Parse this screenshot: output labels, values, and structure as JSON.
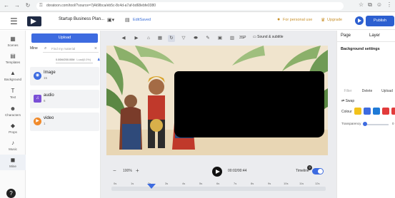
{
  "browser": {
    "url": "doratoon.com/tool/?source=7j4k9lbca/eb5c-8c4d-a7af-bd68ebfe0380"
  },
  "toolbar": {
    "project_title": "Startup Business Plan...",
    "edit_saved": "EditSaved",
    "personal_use": "For personal use",
    "upgrade": "Upgrade",
    "publish": "Publish"
  },
  "rail": {
    "items": [
      {
        "label": "Scenes",
        "icon": "▦"
      },
      {
        "label": "Templates",
        "icon": "▤"
      },
      {
        "label": "Background",
        "icon": "▲"
      },
      {
        "label": "Text",
        "icon": "T"
      },
      {
        "label": "Characters",
        "icon": "☻"
      },
      {
        "label": "Props",
        "icon": "◆"
      },
      {
        "label": "Music",
        "icon": "♪"
      },
      {
        "label": "Mine",
        "icon": "◼"
      }
    ],
    "help": "?"
  },
  "media": {
    "upload_label": "Upload",
    "mine_tab": "Mine",
    "search_placeholder": "Find my material",
    "storage_used": "0.00M/200.00M",
    "storage_link": "Load(0.0%)",
    "items": [
      {
        "label": "Image",
        "count": "15",
        "color": "#3d6be0",
        "icon": "◉"
      },
      {
        "label": "audio",
        "count": "6",
        "color": "#7a4fd6",
        "icon": "♫"
      },
      {
        "label": "video",
        "count": "1",
        "color": "#f08a2b",
        "icon": "▶"
      }
    ]
  },
  "canvas": {
    "toolbar_icons": [
      "◀",
      "▶",
      "⌂",
      "▦",
      "↻",
      "▽",
      "⬬",
      "✎",
      "▣",
      "▥"
    ],
    "toolbar_text": "3SP",
    "subtitle_btn": "Sound & subtitle"
  },
  "playback": {
    "zoom": "100%",
    "time": "00:02/00:44",
    "timeline_label": "Timeline",
    "ruler_ticks": [
      "0s",
      "1s",
      "2s",
      "3s",
      "4s",
      "5s",
      "6s",
      "7s",
      "8s",
      "9s",
      "10s",
      "11s",
      "12s"
    ]
  },
  "right_panel": {
    "tab_page": "Page",
    "tab_layer": "Layer",
    "heading": "Background settings",
    "btn_filter": "Filter",
    "btn_delete": "Delete",
    "btn_upload": "Upload",
    "swap": "Swap",
    "colour_label": "Colour",
    "swatches": [
      "#f2c21b",
      "#3d6be0",
      "#1f7ad6",
      "#e23b3b",
      "#e23b3b"
    ],
    "transparency_label": "Transparency",
    "transparency_value": "0",
    "transparency_level": 0
  }
}
